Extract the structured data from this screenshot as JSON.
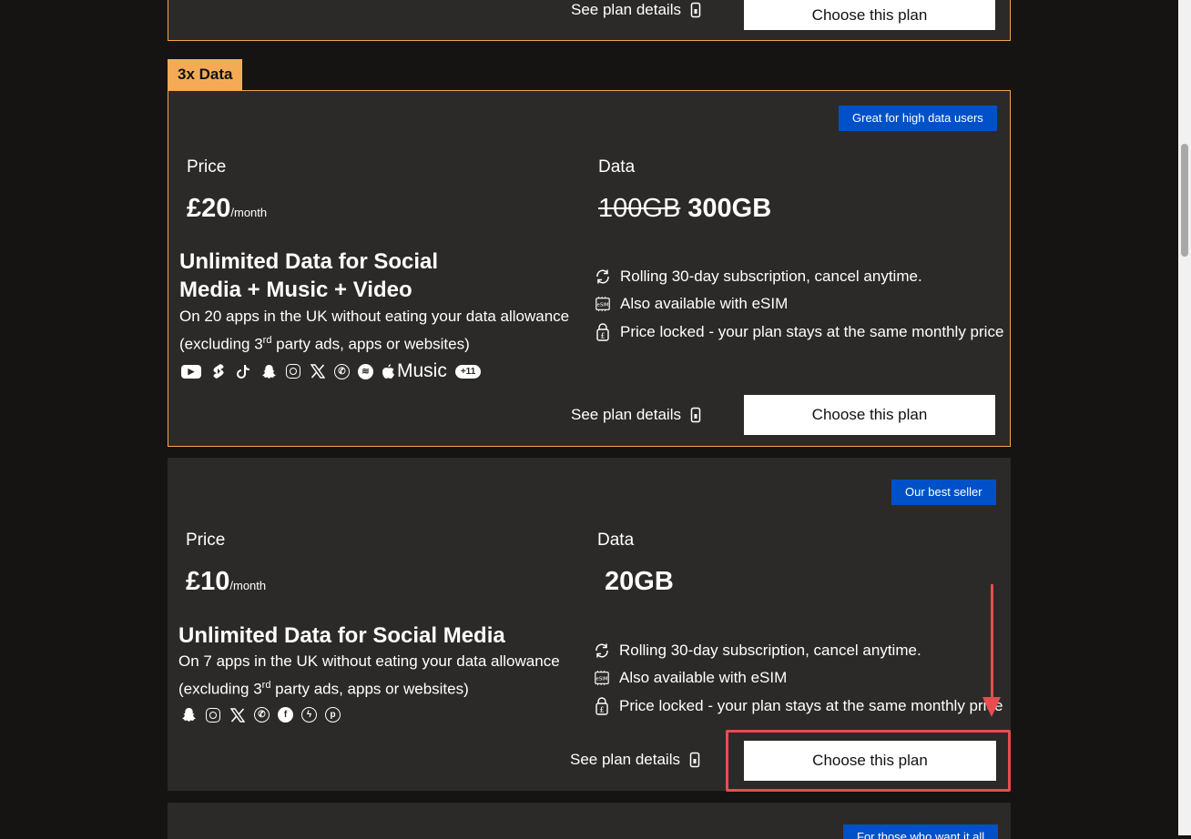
{
  "top_card": {
    "see_details": "See plan details",
    "choose": "Choose this plan"
  },
  "plan_3x": {
    "tag": "3x Data",
    "badge": "Great for high data users",
    "price_label": "Price",
    "price": "£20",
    "per": "/month",
    "data_label": "Data",
    "data_old": "100GB",
    "data_new": "300GB",
    "headline_1": "Unlimited Data for Social",
    "headline_2": "Media + Music + Video",
    "desc_1": "On 20 apps in the UK without eating your data allowance",
    "desc_2a": "(excluding 3",
    "desc_sup": "rd",
    "desc_2b": " party ads, apps or websites)",
    "music": "Music",
    "more": "+11",
    "features": [
      "Rolling 30-day subscription, cancel anytime.",
      "Also available with eSIM",
      "Price locked - your plan stays at the same monthly price"
    ],
    "see_details": "See plan details",
    "choose": "Choose this plan"
  },
  "plan_10": {
    "badge": "Our best seller",
    "price_label": "Price",
    "price": "£10",
    "per": "/month",
    "data_label": "Data",
    "data": "20GB",
    "headline": "Unlimited Data for Social Media",
    "desc_1": "On 7 apps in the UK without eating your data allowance",
    "desc_2a": "(excluding 3",
    "desc_sup": "rd",
    "desc_2b": " party ads, apps or websites)",
    "features": [
      "Rolling 30-day subscription, cancel anytime.",
      "Also available with eSIM",
      "Price locked - your plan stays at the same monthly price"
    ],
    "see_details": "See plan details",
    "choose": "Choose this plan"
  },
  "bottom_card": {
    "badge_partial": "For those who want it all"
  },
  "colors": {
    "accent_orange": "#f5ab56",
    "badge_blue": "#0051c8",
    "highlight_red": "#e84c4f",
    "card_bg": "#2c2a28",
    "page_bg": "#161412"
  },
  "icons": {
    "rolling": "refresh-icon",
    "esim": "esim-chip-icon",
    "lock": "pound-lock-icon",
    "details": "phone-icon"
  }
}
